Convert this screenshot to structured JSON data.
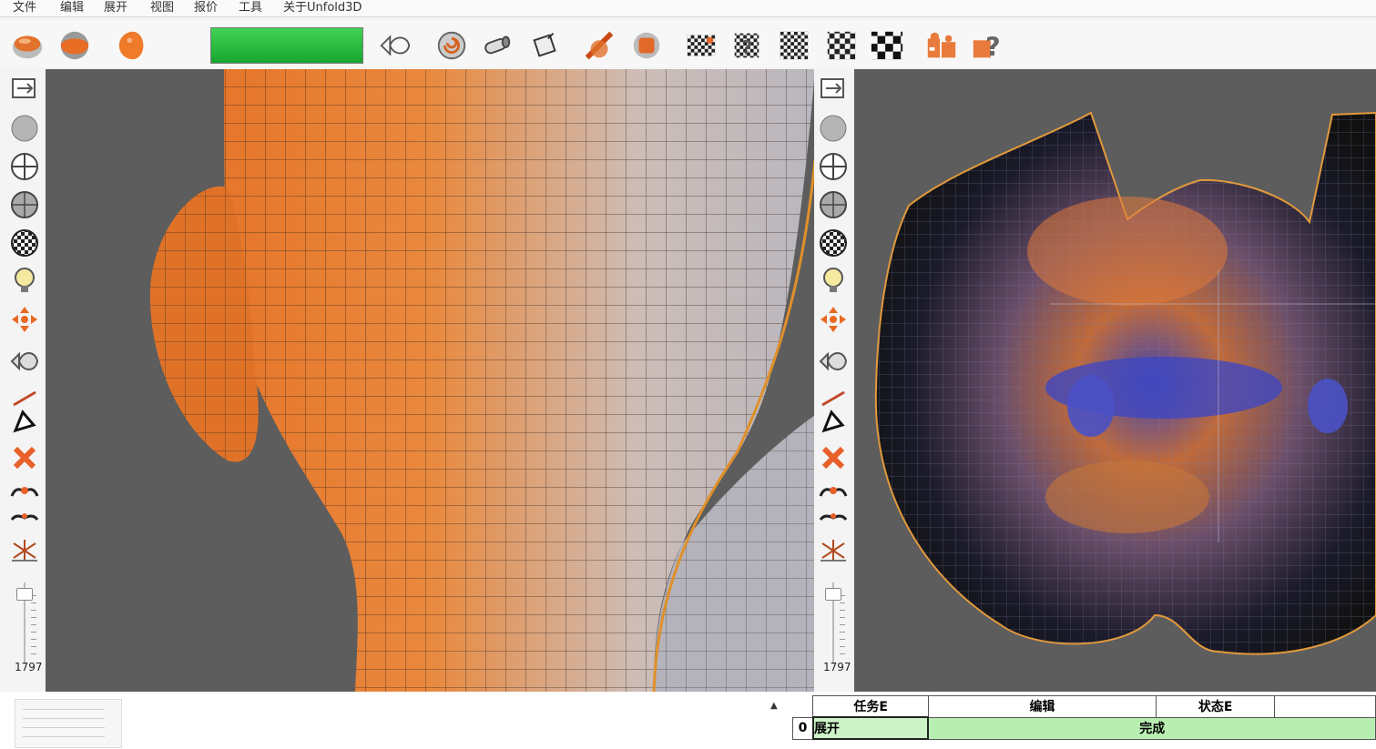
{
  "menu": {
    "items": [
      "文件",
      "编辑",
      "展开",
      "视图",
      "报价",
      "工具",
      "关于Unfold3D"
    ]
  },
  "toolbar": {
    "progress": 1.0,
    "left_icons": [
      "cube-shade-icon",
      "sphere-shade-icon",
      "half-sphere-icon"
    ],
    "right_icons": [
      "fish-select-icon",
      "swirl-icon",
      "pipe-icon",
      "bucket-icon",
      "cut-icon",
      "stop-icon",
      "checker-small-icon",
      "checker-help-icon",
      "checker-medium-icon",
      "checker-large-icon",
      "checker-xl-icon",
      "puzzle-icon",
      "help-icon"
    ]
  },
  "side_tools": [
    "export-icon",
    "grey-sphere-icon",
    "wire-sphere-icon",
    "texture-sphere-icon",
    "checker-sphere-icon",
    "lightbulb-icon",
    "arrows-icon",
    "fish-icon",
    "line-icon",
    "triangle-icon",
    "cross-icon",
    "mustache-icon",
    "mustache-small-icon",
    "star-icon"
  ],
  "left_panel": {
    "slider_value": "1797",
    "slider_level": 0.05
  },
  "right_panel": {
    "slider_value": "1797",
    "slider_level": 0.05
  },
  "task_table": {
    "headers": [
      "任务E",
      "编辑",
      "状态E"
    ],
    "rows": [
      {
        "index": "0",
        "task": "展开",
        "status": "完成"
      }
    ],
    "status_color": "#b9eeb3"
  }
}
